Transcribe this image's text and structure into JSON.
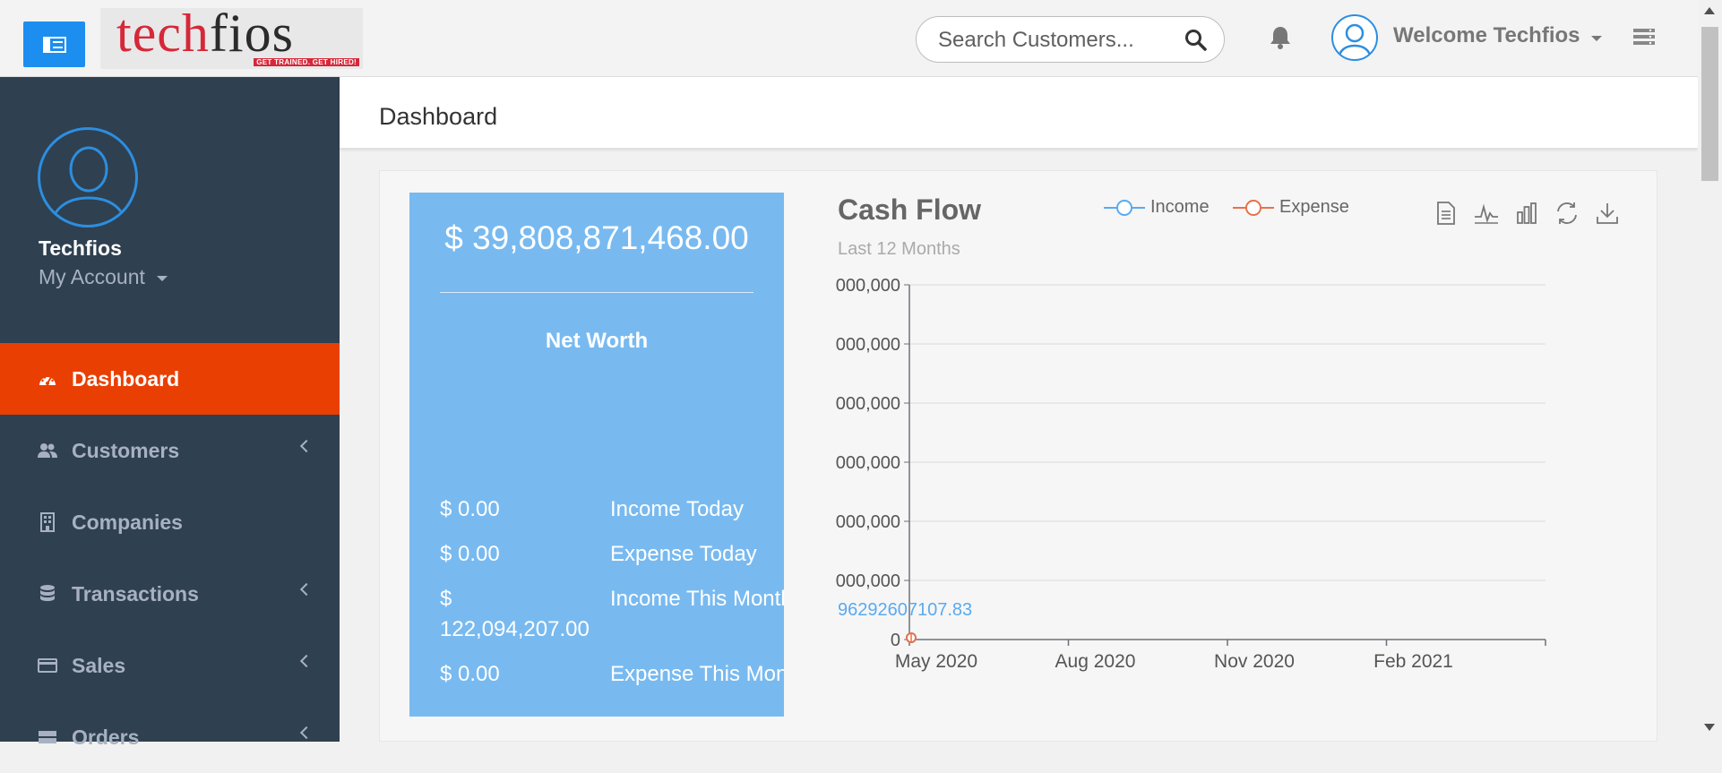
{
  "topbar": {
    "logo": {
      "part1": "tech",
      "part2": "fios",
      "tagline": "GET TRAINED. GET HIRED!"
    },
    "search_placeholder": "Search Customers...",
    "welcome": "Welcome Techfios"
  },
  "sidebar": {
    "user_name": "Techfios",
    "account_label": "My Account",
    "items": [
      {
        "label": "Dashboard",
        "icon": "dashboard-icon",
        "active": true
      },
      {
        "label": "Customers",
        "icon": "users-icon",
        "has_submenu": true
      },
      {
        "label": "Companies",
        "icon": "building-icon"
      },
      {
        "label": "Transactions",
        "icon": "database-icon",
        "has_submenu": true
      },
      {
        "label": "Sales",
        "icon": "credit-card-icon",
        "has_submenu": true
      },
      {
        "label": "Orders",
        "icon": "server-icon",
        "has_submenu": true
      }
    ]
  },
  "page": {
    "title": "Dashboard"
  },
  "networth": {
    "amount": "$ 39,808,871,468.00",
    "label": "Net Worth",
    "rows": [
      {
        "value": "$ 0.00",
        "label": "Income Today"
      },
      {
        "value": "$ 0.00",
        "label": "Expense Today"
      },
      {
        "value": "$ 122,094,207.00",
        "label": "Income This Month"
      },
      {
        "value": "$ 0.00",
        "label": "Expense This Month"
      }
    ]
  },
  "chart": {
    "title": "Cash Flow",
    "subtitle": "Last 12 Months",
    "toolbar_icons": [
      "data-view-icon",
      "line-chart-icon",
      "bar-chart-icon",
      "refresh-icon",
      "download-icon"
    ]
  },
  "chart_data": {
    "type": "line",
    "title": "Cash Flow",
    "subtitle": "Last 12 Months",
    "y_tick_labels": [
      "0",
      "000,000",
      "000,000",
      "000,000",
      "000,000",
      "000,000",
      "000,000"
    ],
    "x_tick_labels": [
      "May 2020",
      "Aug 2020",
      "Nov 2020",
      "Feb 2021"
    ],
    "series": [
      {
        "name": "Income",
        "color": "#5aaaf0",
        "points": [
          {
            "x": "May 2020",
            "y": 96292607107.83
          }
        ],
        "data_labels": [
          "96292607107.83"
        ]
      },
      {
        "name": "Expense",
        "color": "#e8714c",
        "points": [
          {
            "x": "May 2020",
            "y": 0
          }
        ]
      }
    ],
    "legend_position": "top",
    "grid": true
  },
  "colors": {
    "accent_blue": "#1c8ef0",
    "active_nav": "#ea3f02",
    "sidebar_bg": "#2f4050",
    "networth_bg": "#78baf0"
  }
}
